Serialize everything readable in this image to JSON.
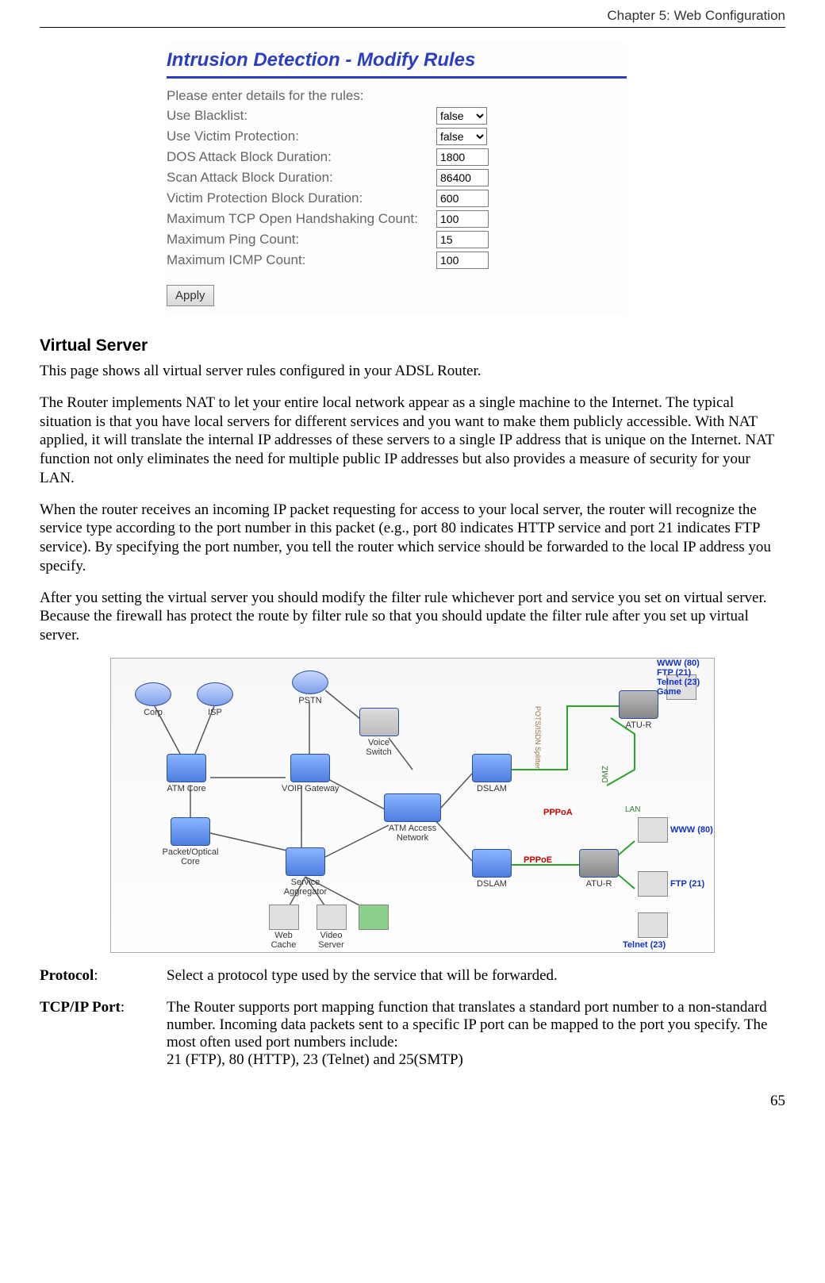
{
  "chapter": "Chapter 5: Web Configuration",
  "page_number": "65",
  "form": {
    "title": "Intrusion Detection - Modify Rules",
    "intro": "Please enter details for the rules:",
    "fields": [
      {
        "label": "Use Blacklist:",
        "type": "select",
        "value": "false"
      },
      {
        "label": "Use Victim Protection:",
        "type": "select",
        "value": "false"
      },
      {
        "label": "DOS Attack Block Duration:",
        "type": "text",
        "value": "1800"
      },
      {
        "label": "Scan Attack Block Duration:",
        "type": "text",
        "value": "86400"
      },
      {
        "label": "Victim Protection Block Duration:",
        "type": "text",
        "value": "600"
      },
      {
        "label": "Maximum TCP Open Handshaking Count:",
        "type": "text",
        "value": "100"
      },
      {
        "label": "Maximum Ping Count:",
        "type": "text",
        "value": "15"
      },
      {
        "label": "Maximum ICMP Count:",
        "type": "text",
        "value": "100"
      }
    ],
    "apply": "Apply"
  },
  "section_heading": "Virtual Server",
  "paragraphs": [
    "This page shows all virtual server rules configured in your ADSL Router.",
    "The Router implements NAT to let your entire local network appear as a single machine to the Internet. The typical situation is that you have local servers for different services and you want to make them publicly accessible. With NAT applied, it will translate the internal IP addresses of these servers to a single IP address that is unique on the Internet. NAT function not only eliminates the need for multiple public IP addresses but also provides a measure of security for your LAN.",
    "When the router receives an incoming IP packet requesting for access to your local server, the router will recognize the service type according to the port number in this packet (e.g., port 80 indicates HTTP service and port 21 indicates FTP service). By specifying the port number, you tell the router which service should be forwarded to the local IP address you specify.",
    "After you setting the virtual server you should modify the filter rule whichever port and service you set on virtual server. Because the firewall has protect the route by filter rule so that you should update the filter rule after you set up virtual server."
  ],
  "diagram": {
    "nodes": {
      "corp": "Corp",
      "isp": "ISP",
      "atmcore": "ATM Core",
      "pktopt": "Packet/Optical\nCore",
      "voipgw": "VOIP Gateway",
      "svcagg": "Service\nAggregator",
      "pstn": "PSTN",
      "vswitch": "Voice\nSwitch",
      "atmacc": "ATM Access Network",
      "dslam1": "DSLAM",
      "dslam2": "DSLAM",
      "atur1": "ATU-R",
      "atur2": "ATU-R",
      "webcache": "Web\nCache",
      "videosrv": "Video\nServer",
      "dmz": "DMZ",
      "lan": "LAN",
      "possplit": "POTS/ISDN Splitter"
    },
    "link_labels": {
      "pppoa": "PPPoA",
      "pppoe": "PPPoE"
    },
    "service_labels": {
      "top": "WWW (80)\nFTP (21)\nTelnet (23)\nGame",
      "www": "WWW (80)",
      "ftp": "FTP (21)",
      "telnet": "Telnet (23)"
    }
  },
  "definitions": [
    {
      "term": "Protocol",
      "sep": ":",
      "desc": "Select a protocol type used by the service that will be forwarded."
    },
    {
      "term": "TCP/IP Port",
      "sep": ":",
      "desc": "The Router supports port mapping function that translates a standard port number to a non-standard number. Incoming data packets sent to a specific IP port can be mapped to the port you specify. The most often used port numbers include:\n21 (FTP), 80 (HTTP), 23 (Telnet) and 25(SMTP)"
    }
  ]
}
